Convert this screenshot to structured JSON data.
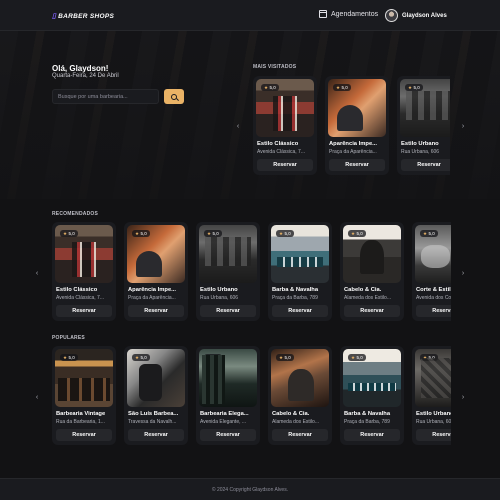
{
  "header": {
    "logo_mark": "▯",
    "logo_text": "BARBER SHOPS",
    "bookings_label": "Agendamentos",
    "bookings_icon": "calendar-icon",
    "user_name": "Glaydson Alves"
  },
  "hero": {
    "greeting": "Olá, Glaydson!",
    "date": "Quarta-Feira, 24 De Abril",
    "search_placeholder": "Busque por uma barbearia...",
    "search_icon": "search-icon"
  },
  "sections": {
    "most_visited": "MAIS VISITADOS",
    "recommended": "RECOMENDADOS",
    "popular": "POPULARES"
  },
  "reserve_label": "Reservar",
  "rating_value": "5,0",
  "most_visited": [
    {
      "name": "Estilo Clássico",
      "address": "Avenida Clássica, 7...",
      "photo": "p1"
    },
    {
      "name": "Aparência Impe...",
      "address": "Praça da Aparência...",
      "photo": "p2"
    },
    {
      "name": "Estilo Urbano",
      "address": "Rua Urbana, 606",
      "photo": "p3"
    }
  ],
  "recommended": [
    {
      "name": "Estilo Clássico",
      "address": "Avenida Clássica, 7...",
      "photo": "p1"
    },
    {
      "name": "Aparência Impe...",
      "address": "Praça da Aparência...",
      "photo": "p2"
    },
    {
      "name": "Estilo Urbano",
      "address": "Rua Urbana, 606",
      "photo": "p3"
    },
    {
      "name": "Barba & Navalha",
      "address": "Praça da Barba, 789",
      "photo": "p4"
    },
    {
      "name": "Cabelo & Cia.",
      "address": "Alameda dos Estilo...",
      "photo": "p5"
    },
    {
      "name": "Corte & Estilo",
      "address": "Avenida dos Cortes...",
      "photo": "p6"
    }
  ],
  "popular": [
    {
      "name": "Barbearia Vintage",
      "address": "Rua da Barbearia, 1...",
      "photo": "p7"
    },
    {
      "name": "São Luís Barbea...",
      "address": "Travessa da Navalh...",
      "photo": "p8"
    },
    {
      "name": "Barbearia Elega...",
      "address": "Avenida Elegante, ...",
      "photo": "p9"
    },
    {
      "name": "Cabelo & Cia.",
      "address": "Alameda dos Estilo...",
      "photo": "p10"
    },
    {
      "name": "Barba & Navalha",
      "address": "Praça da Barba, 789",
      "photo": "p11"
    },
    {
      "name": "Estilo Urbano",
      "address": "Rua Urbana, 606",
      "photo": "p12"
    }
  ],
  "arrows": {
    "left": "‹",
    "right": "›"
  },
  "footer": "© 2024 Copyright Glaydson Alves."
}
